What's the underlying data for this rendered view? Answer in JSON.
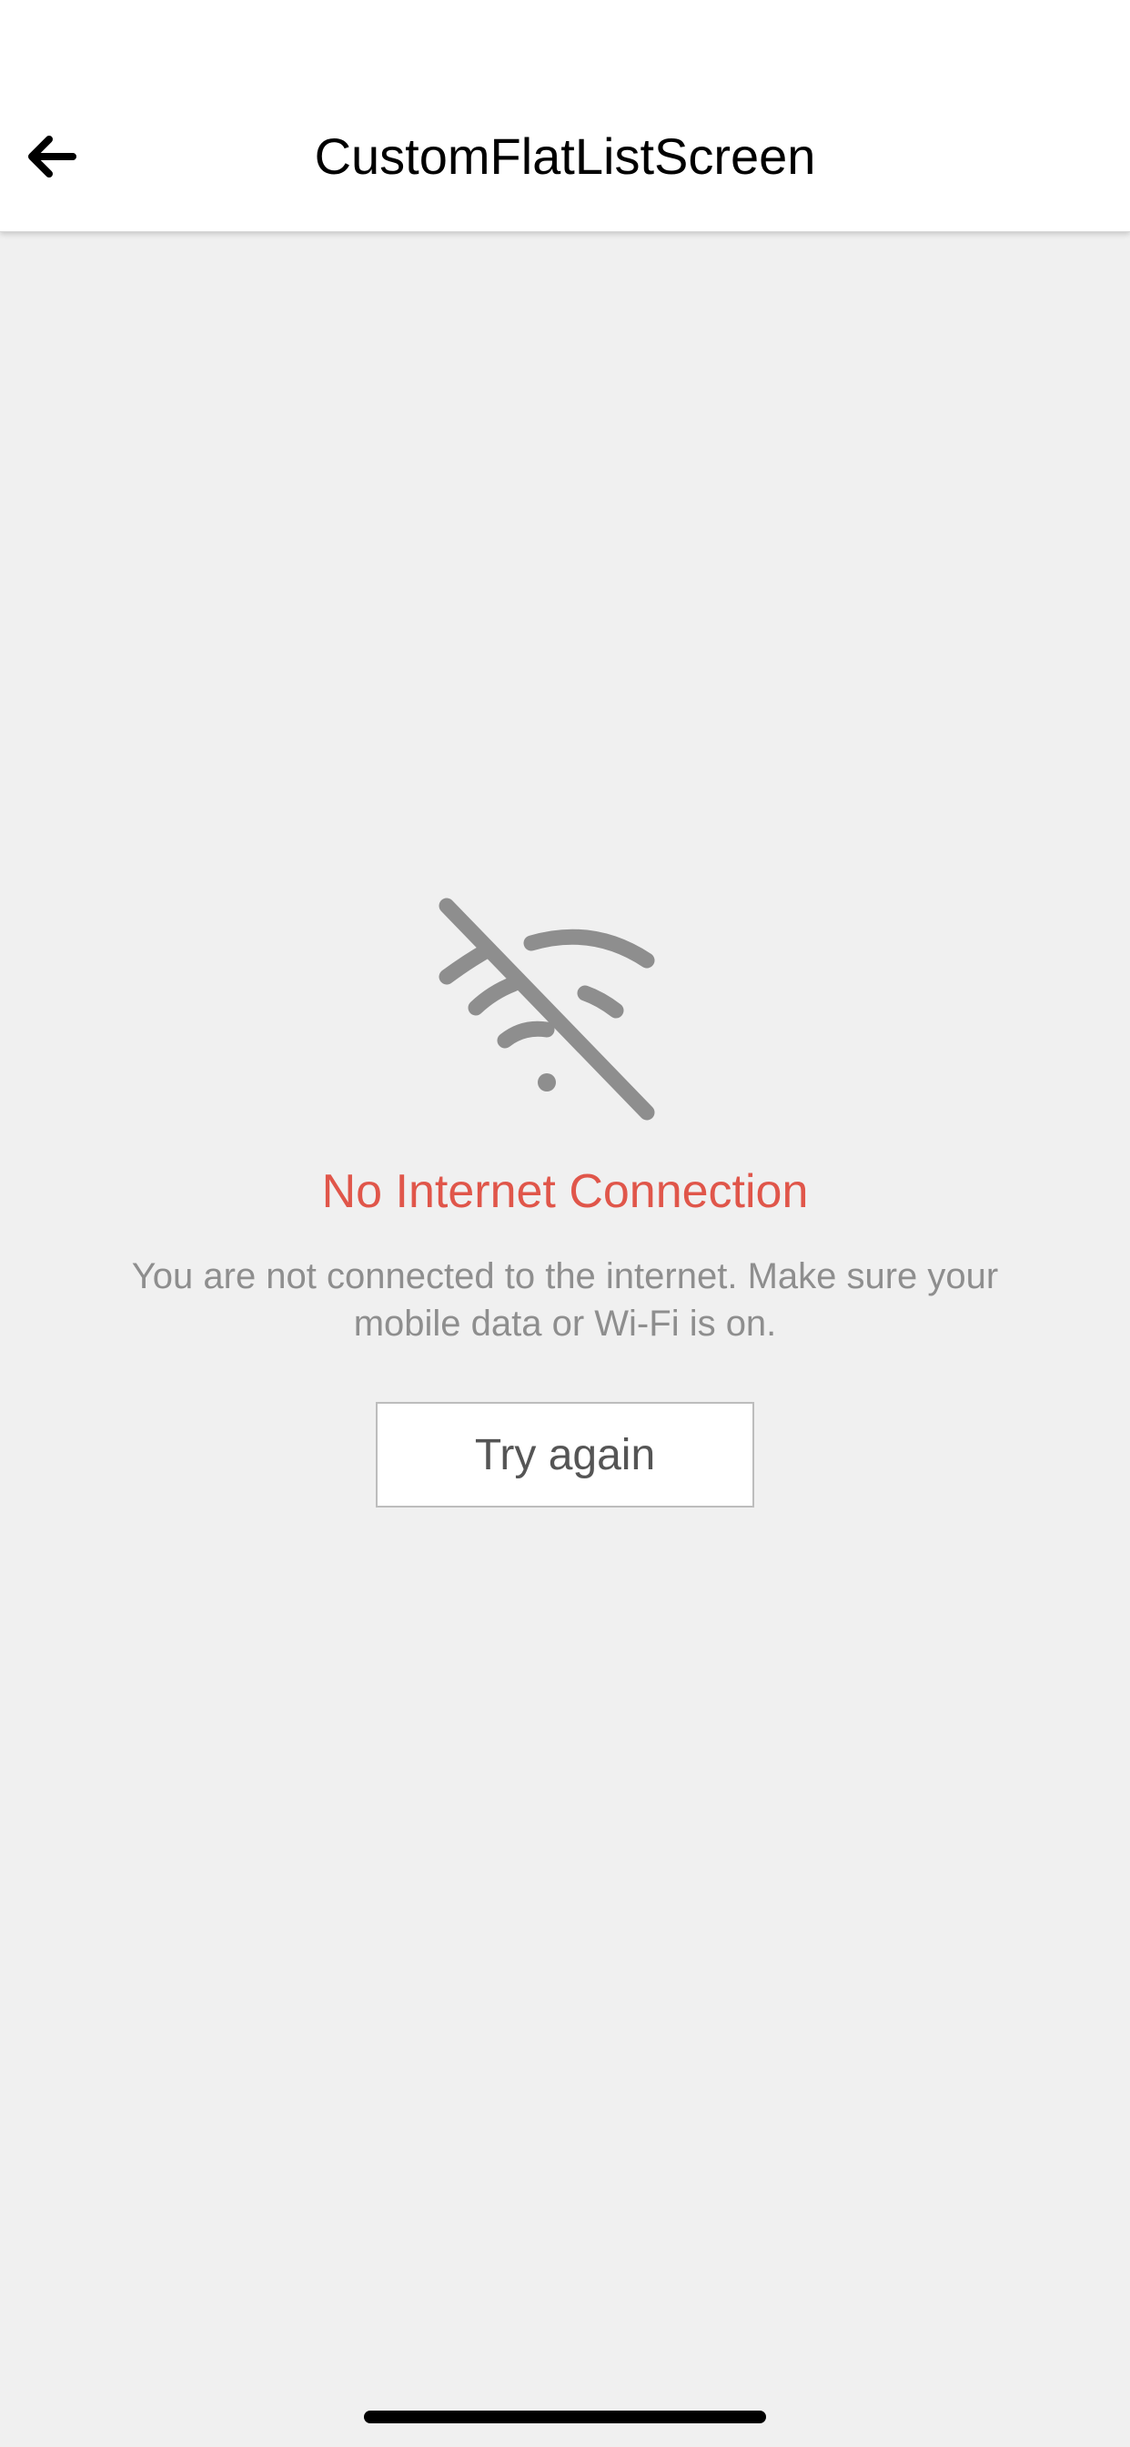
{
  "header": {
    "title": "CustomFlatListScreen",
    "back_icon": "arrow-left-icon"
  },
  "error": {
    "icon": "wifi-off-icon",
    "title": "No Internet Connection",
    "message": "You are not connected to the internet. Make sure your mobile data or Wi-Fi is on.",
    "retry_label": "Try again"
  },
  "colors": {
    "background": "#f0f0f0",
    "header_background": "#ffffff",
    "error_title": "#e0564a",
    "icon": "#8e8e8e",
    "message": "#8e8e8e",
    "button_text": "#555555"
  }
}
